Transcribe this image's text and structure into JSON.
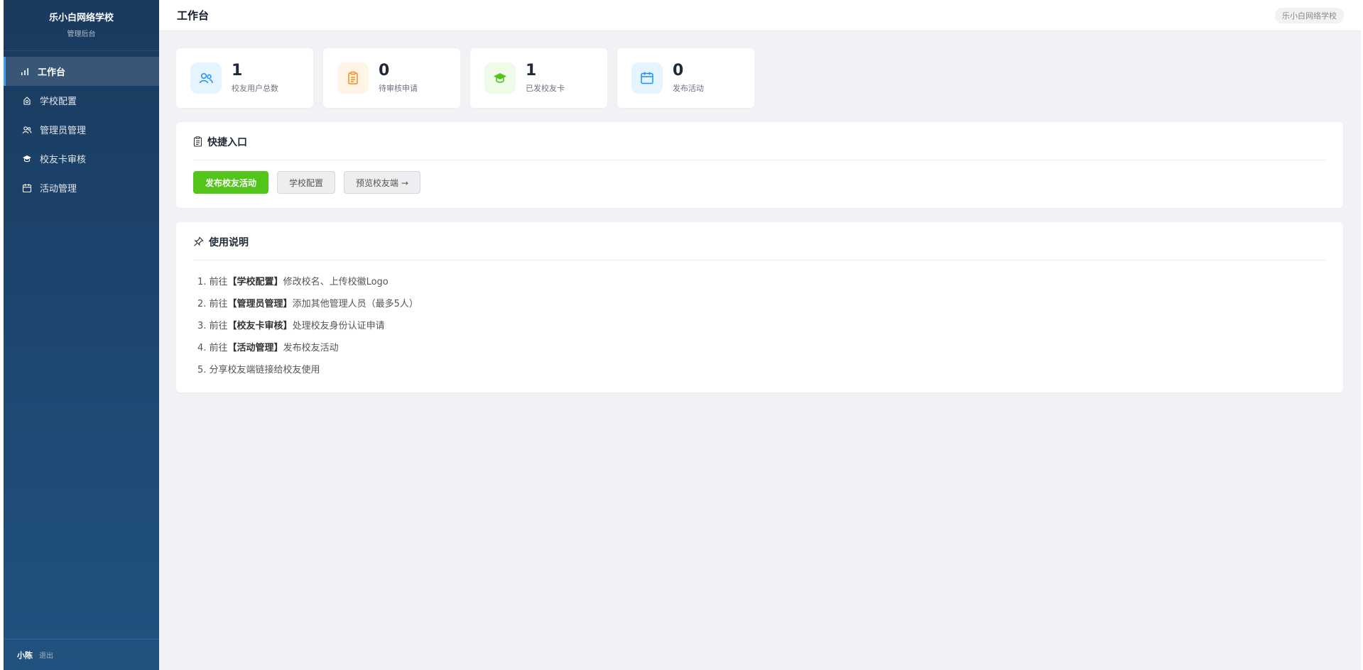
{
  "brand": {
    "title": "乐小白网络学校",
    "subtitle": "管理后台"
  },
  "nav": [
    {
      "label": "工作台",
      "icon": "bar-chart-icon",
      "active": true
    },
    {
      "label": "学校配置",
      "icon": "school-config-icon",
      "active": false
    },
    {
      "label": "管理员管理",
      "icon": "users-icon",
      "active": false
    },
    {
      "label": "校友卡审核",
      "icon": "graduation-cap-icon",
      "active": false
    },
    {
      "label": "活动管理",
      "icon": "calendar-icon",
      "active": false
    }
  ],
  "footer": {
    "user": "小陈",
    "logout": "退出"
  },
  "header": {
    "title": "工作台",
    "school_badge": "乐小白网络学校"
  },
  "stats": [
    {
      "value": "1",
      "label": "校友用户总数",
      "icon": "users-icon",
      "color": "#1890ff",
      "bg": "#e6f4ff"
    },
    {
      "value": "0",
      "label": "待审核申请",
      "icon": "clipboard-icon",
      "color": "#fa8c16",
      "bg": "#fff4e5"
    },
    {
      "value": "1",
      "label": "已发校友卡",
      "icon": "graduation-cap-icon",
      "color": "#52c41a",
      "bg": "#eefbe7"
    },
    {
      "value": "0",
      "label": "发布活动",
      "icon": "calendar-icon",
      "color": "#1890ff",
      "bg": "#e6f4ff"
    }
  ],
  "quick": {
    "title": "快捷入口",
    "buttons": [
      {
        "label": "发布校友活动"
      },
      {
        "label": "学校配置"
      },
      {
        "label": "预览校友端 →"
      }
    ]
  },
  "guide": {
    "title": "使用说明",
    "steps": [
      {
        "prefix": "1. 前往",
        "bold": "【学校配置】",
        "text": "修改校名、上传校徽Logo"
      },
      {
        "prefix": "2. 前往",
        "bold": "【管理员管理】",
        "text": "添加其他管理人员（最多5人）"
      },
      {
        "prefix": "3. 前往",
        "bold": "【校友卡审核】",
        "text": "处理校友身份认证申请"
      },
      {
        "prefix": "4. 前往",
        "bold": "【活动管理】",
        "text": "发布校友活动"
      },
      {
        "prefix": "5. 分享校友端链接给校友使用",
        "bold": "",
        "text": ""
      }
    ]
  }
}
